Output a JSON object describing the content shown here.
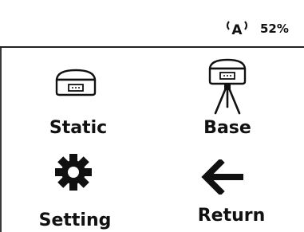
{
  "status_bar": {
    "signal_icon": "radio-signal-A-icon",
    "signal_letter": "A",
    "battery_text": "52%"
  },
  "menu": {
    "items": [
      {
        "id": "static",
        "label": "Static",
        "icon": "receiver-icon"
      },
      {
        "id": "base",
        "label": "Base",
        "icon": "receiver-on-tripod-icon"
      },
      {
        "id": "setting",
        "label": "Setting",
        "icon": "gear-icon"
      },
      {
        "id": "return",
        "label": "Return",
        "icon": "arrow-left-icon"
      }
    ]
  },
  "colors": {
    "foreground": "#111111",
    "background": "#ffffff",
    "divider": "#222222"
  }
}
